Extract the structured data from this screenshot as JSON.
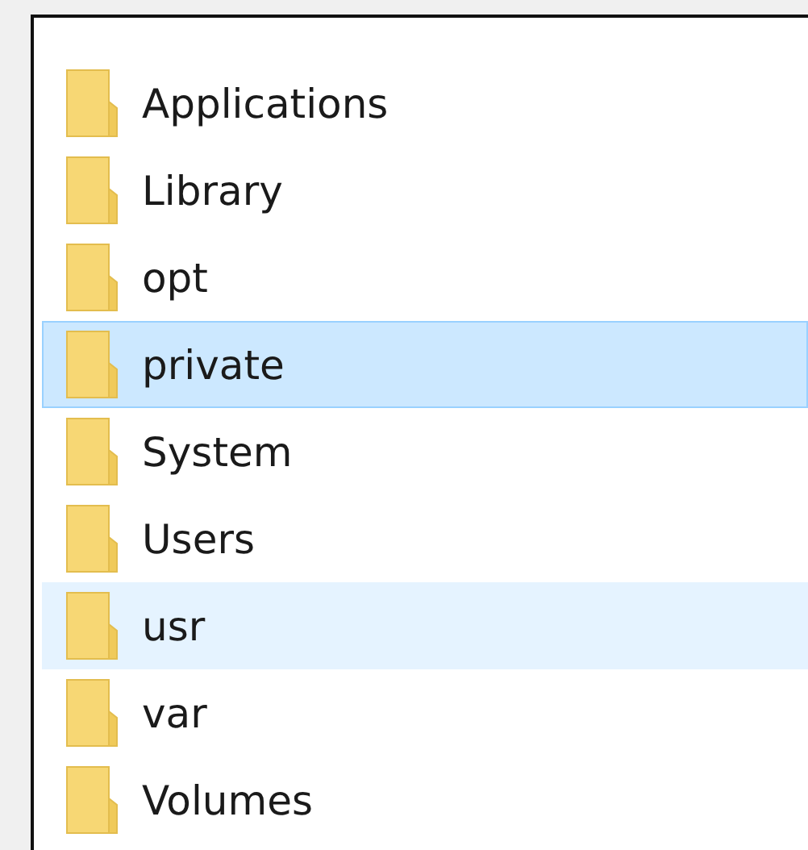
{
  "folders": [
    {
      "name": "Applications",
      "selected": false,
      "hovered": false
    },
    {
      "name": "Library",
      "selected": false,
      "hovered": false
    },
    {
      "name": "opt",
      "selected": false,
      "hovered": false
    },
    {
      "name": "private",
      "selected": true,
      "hovered": false
    },
    {
      "name": "System",
      "selected": false,
      "hovered": false
    },
    {
      "name": "Users",
      "selected": false,
      "hovered": false
    },
    {
      "name": "usr",
      "selected": false,
      "hovered": true
    },
    {
      "name": "var",
      "selected": false,
      "hovered": false
    },
    {
      "name": "Volumes",
      "selected": false,
      "hovered": false
    }
  ]
}
